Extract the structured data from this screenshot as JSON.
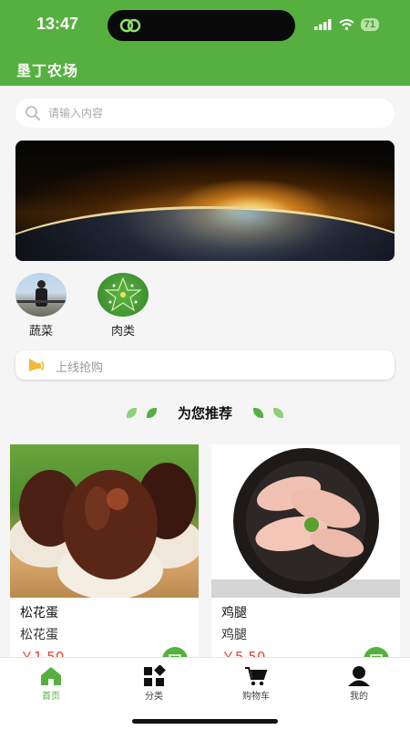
{
  "status_bar": {
    "time": "13:47",
    "battery": "71"
  },
  "header": {
    "title": "垦丁农场"
  },
  "search": {
    "placeholder": "请输入内容"
  },
  "categories": [
    {
      "label": "蔬菜"
    },
    {
      "label": "肉类"
    }
  ],
  "flash_sale": {
    "label": "上线抢购"
  },
  "section": {
    "title": "为您推荐"
  },
  "products": [
    {
      "name": "松花蛋",
      "desc": "松花蛋",
      "price": "￥1.50"
    },
    {
      "name": "鸡腿",
      "desc": "鸡腿",
      "price": "￥5.50"
    }
  ],
  "tabbar": {
    "items": [
      {
        "label": "首页",
        "icon": "home-icon",
        "active": true
      },
      {
        "label": "分类",
        "icon": "category-icon",
        "active": false
      },
      {
        "label": "购物车",
        "icon": "cart-icon",
        "active": false
      },
      {
        "label": "我的",
        "icon": "user-icon",
        "active": false
      }
    ]
  },
  "colors": {
    "brand": "#56b03f",
    "price": "#e5452f"
  }
}
